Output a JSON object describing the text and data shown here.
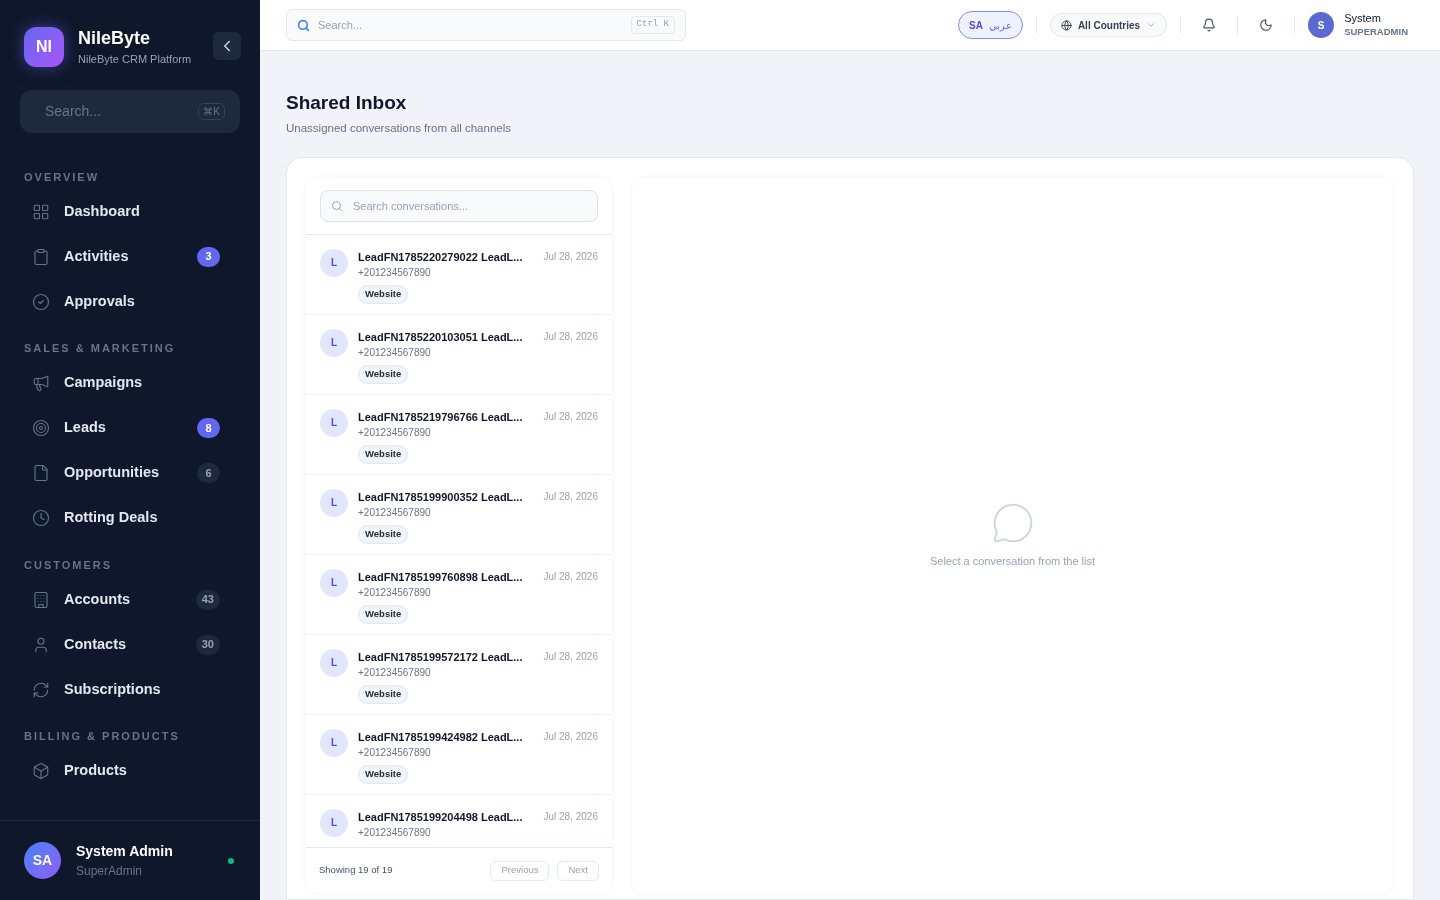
{
  "brand": {
    "logo": "NI",
    "name": "NileByte",
    "subtitle": "NileByte CRM Platform"
  },
  "sidebar_search": {
    "placeholder": "Search...",
    "shortcut": "⌘K"
  },
  "sections": [
    {
      "title": "OVERVIEW",
      "items": [
        {
          "label": "Dashboard"
        },
        {
          "label": "Activities",
          "badge": "3",
          "highlighted": true
        },
        {
          "label": "Approvals"
        }
      ]
    },
    {
      "title": "SALES & MARKETING",
      "items": [
        {
          "label": "Campaigns"
        },
        {
          "label": "Leads",
          "badge": "8",
          "highlighted": true
        },
        {
          "label": "Opportunities",
          "badge": "6",
          "highlighted": false
        },
        {
          "label": "Rotting Deals"
        }
      ]
    },
    {
      "title": "CUSTOMERS",
      "items": [
        {
          "label": "Accounts",
          "badge": "43",
          "highlighted": false
        },
        {
          "label": "Contacts",
          "badge": "30",
          "highlighted": false
        },
        {
          "label": "Subscriptions"
        }
      ]
    },
    {
      "title": "BILLING & PRODUCTS",
      "items": [
        {
          "label": "Products"
        }
      ]
    }
  ],
  "user": {
    "initials": "SA",
    "name": "System Admin",
    "role": "SuperAdmin",
    "online": true
  },
  "topbar": {
    "search_placeholder": "Search...",
    "shortcut": "Ctrl K",
    "lang_code": "SA",
    "lang_label": "عربي",
    "country": "All Countries",
    "avatar": "S",
    "dark_mode": false,
    "user_name": "System",
    "user_role": "SUPERADMIN"
  },
  "page": {
    "title": "Shared Inbox",
    "subtitle": "Unassigned conversations from all channels"
  },
  "inbox": {
    "search_placeholder": "Search conversations...",
    "conversations": [
      {
        "avatar": "L",
        "name": "LeadFN1785220279022 LeadL...",
        "phone": "+201234567890",
        "date": "Jul 28, 2026",
        "tag": "Website"
      },
      {
        "avatar": "L",
        "name": "LeadFN1785220103051 LeadL...",
        "phone": "+201234567890",
        "date": "Jul 28, 2026",
        "tag": "Website"
      },
      {
        "avatar": "L",
        "name": "LeadFN1785219796766 LeadL...",
        "phone": "+201234567890",
        "date": "Jul 28, 2026",
        "tag": "Website"
      },
      {
        "avatar": "L",
        "name": "LeadFN1785199900352 LeadL...",
        "phone": "+201234567890",
        "date": "Jul 28, 2026",
        "tag": "Website"
      },
      {
        "avatar": "L",
        "name": "LeadFN1785199760898 LeadL...",
        "phone": "+201234567890",
        "date": "Jul 28, 2026",
        "tag": "Website"
      },
      {
        "avatar": "L",
        "name": "LeadFN1785199572172 LeadL...",
        "phone": "+201234567890",
        "date": "Jul 28, 2026",
        "tag": "Website"
      },
      {
        "avatar": "L",
        "name": "LeadFN1785199424982 LeadL...",
        "phone": "+201234567890",
        "date": "Jul 28, 2026",
        "tag": "Website"
      },
      {
        "avatar": "L",
        "name": "LeadFN1785199204498 LeadL...",
        "phone": "+201234567890",
        "date": "Jul 28, 2026"
      }
    ],
    "showing": "Showing 19 of 19",
    "prev": "Previous",
    "next": "Next",
    "empty": "Select a conversation from the list"
  }
}
